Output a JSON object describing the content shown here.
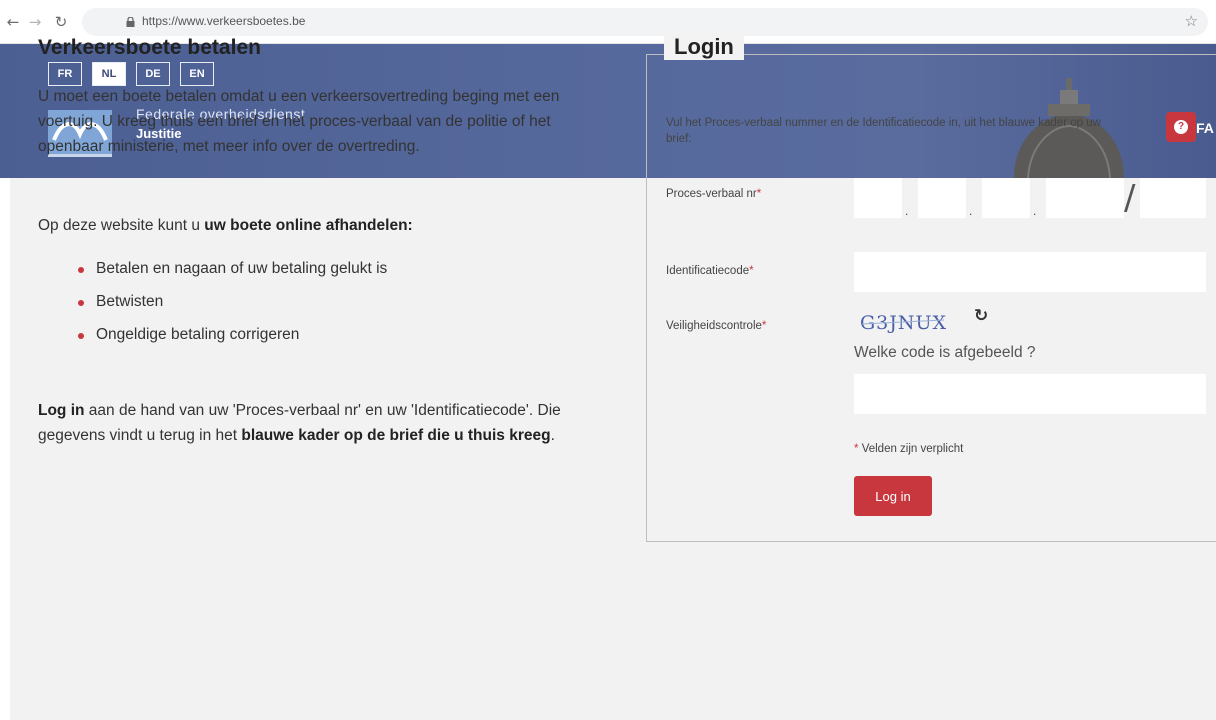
{
  "browser": {
    "url": "https://www.verkeersboetes.be"
  },
  "banner": {
    "languages": [
      "FR",
      "NL",
      "DE",
      "EN"
    ],
    "active_language": "NL",
    "org_line1": "Federale overheidsdienst",
    "org_line2": "Justitie",
    "right_text": "FA"
  },
  "left": {
    "title": "Verkeersboete betalen",
    "intro": "U moet een boete betalen omdat u een verkeersovertreding beging met een voertuig. U kreeg thuis een brief en het proces-verbaal van de politie of het openbaar ministerie, met meer info over de overtreding.",
    "p2_prefix": "Op deze website kunt u ",
    "p2_bold": "uw boete online afhandelen:",
    "bullets": [
      "Betalen en nagaan of uw betaling gelukt is",
      "Betwisten",
      "Ongeldige betaling corrigeren"
    ],
    "p3_bold1": "Log in",
    "p3_text1": " aan de hand van uw 'Proces-verbaal nr' en uw 'Identificatiecode'. Die gegevens vindt u terug in het ",
    "p3_bold2": "blauwe kader op de brief die u thuis kreeg",
    "p3_text2": "."
  },
  "login": {
    "legend": "Login",
    "description": "Vul het Proces-verbaal nummer en de Identificatiecode in, uit het blauwe kader op uw brief:",
    "pv_label": "Proces-verbaal nr",
    "id_label": "Identificatiecode",
    "captcha_label": "Veiligheidscontrole",
    "required_mark": "*",
    "pv_separators": [
      ".",
      ".",
      "."
    ],
    "pv_slash": "/",
    "captcha_text": "G3JNUX",
    "captcha_question": "Welke code is afgebeeld ?",
    "required_note": "Velden zijn verplicht",
    "submit_label": "Log in"
  },
  "colors": {
    "accent": "#c8363e",
    "banner": "#55689c",
    "background": "#f2f2f2"
  },
  "icons": {
    "back": "back-arrow-icon",
    "forward": "forward-arrow-icon",
    "reload": "reload-icon",
    "lock": "lock-icon",
    "star": "star-icon",
    "help": "help-icon",
    "refresh": "refresh-captcha-icon"
  }
}
